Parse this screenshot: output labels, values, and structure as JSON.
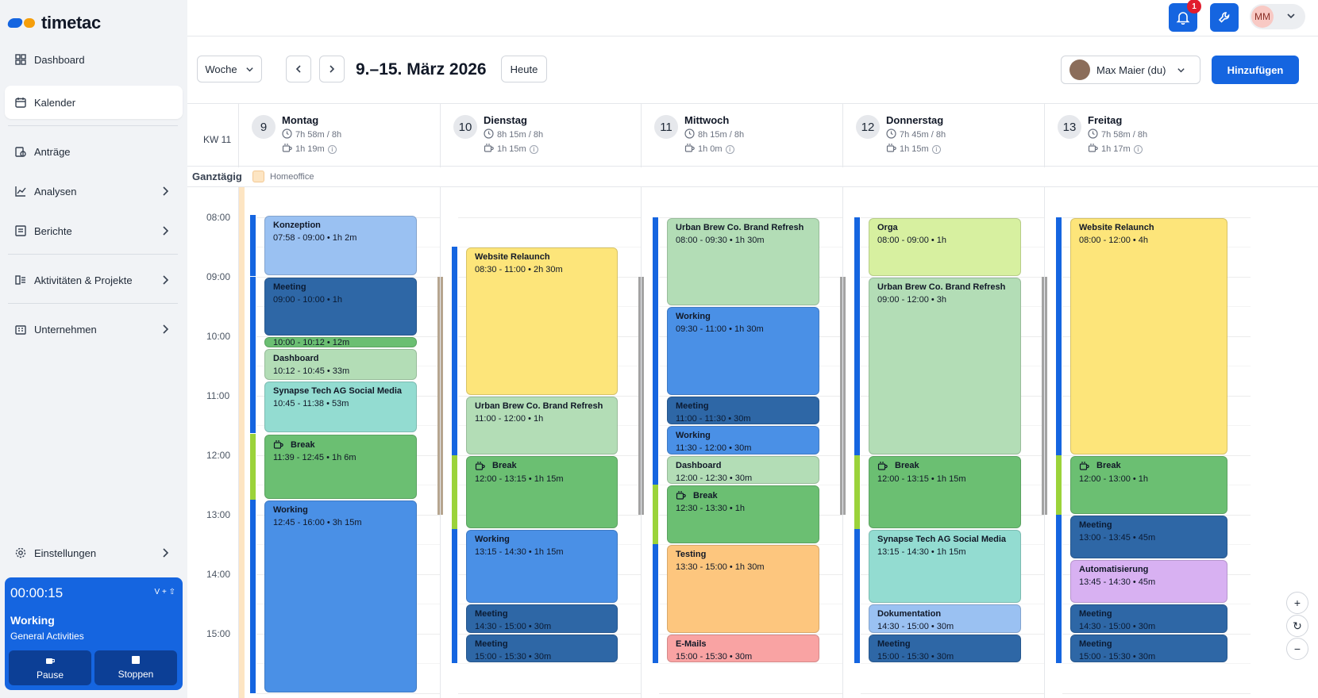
{
  "app": {
    "brand": "timetac"
  },
  "sidebar": {
    "items": [
      {
        "label": "Dashboard",
        "icon": "dashboard-icon"
      },
      {
        "label": "Kalender",
        "icon": "calendar-icon"
      },
      {
        "label": "Anträge",
        "icon": "requests-icon"
      },
      {
        "label": "Analysen",
        "icon": "chart-icon"
      },
      {
        "label": "Berichte",
        "icon": "reports-icon"
      },
      {
        "label": "Aktivitäten & Projekte",
        "icon": "projects-icon"
      },
      {
        "label": "Unternehmen",
        "icon": "building-icon"
      },
      {
        "label": "Einstellungen",
        "icon": "gear-icon"
      }
    ]
  },
  "timer": {
    "time": "00:00:15",
    "shortcut": "V + ⇧",
    "title": "Working",
    "subtitle": "General Activities",
    "pause_label": "Pause",
    "stop_label": "Stoppen"
  },
  "header": {
    "notifications": "1",
    "user_initials": "MM"
  },
  "toolbar": {
    "view": "Woche",
    "date_range": "9.–15. März 2026",
    "today": "Heute",
    "person": "Max Maier (du)",
    "add": "Hinzufügen"
  },
  "calendar": {
    "week_label": "KW 11",
    "allday_label": "Ganztägig",
    "allday_event": "Homeoffice",
    "hours": [
      "08:00",
      "09:00",
      "10:00",
      "11:00",
      "12:00",
      "13:00",
      "14:00",
      "15:00"
    ],
    "days": [
      {
        "num": "9",
        "name": "Montag",
        "work": "7h 58m / 8h",
        "break": "1h 19m"
      },
      {
        "num": "10",
        "name": "Dienstag",
        "work": "8h 15m / 8h",
        "break": "1h 15m"
      },
      {
        "num": "11",
        "name": "Mittwoch",
        "work": "8h 15m / 8h",
        "break": "1h 0m"
      },
      {
        "num": "12",
        "name": "Donnerstag",
        "work": "7h 45m / 8h",
        "break": "1h 15m"
      },
      {
        "num": "13",
        "name": "Freitag",
        "work": "7h 58m / 8h",
        "break": "1h 17m"
      }
    ]
  },
  "events": [
    [
      {
        "title": "Konzeption",
        "time": "07:58 - 09:00 • 1h 2m",
        "start": 7.967,
        "end": 9.0,
        "color": "#9ac1f2"
      },
      {
        "title": "Meeting",
        "time": "09:00 - 10:00 • 1h",
        "start": 9.0,
        "end": 10.0,
        "color": "#2e67a6"
      },
      {
        "title": "",
        "time": "10:00 - 10:12 • 12m",
        "start": 10.0,
        "end": 10.2,
        "color": "#6bbf72"
      },
      {
        "title": "Dashboard",
        "time": "10:12 - 10:45 • 33m",
        "start": 10.2,
        "end": 10.75,
        "color": "#b3ddb6"
      },
      {
        "title": "Synapse Tech AG Social Media",
        "time": "10:45 - 11:38 • 53m",
        "start": 10.75,
        "end": 11.633,
        "color": "#93dcd1"
      },
      {
        "title": "Break",
        "time": "11:39 - 12:45 • 1h 6m",
        "start": 11.65,
        "end": 12.75,
        "color": "#6bbf72",
        "icon": "coffee"
      },
      {
        "title": "Working",
        "time": "12:45 - 16:00 • 3h 15m",
        "start": 12.75,
        "end": 16.0,
        "color": "#4a90e6"
      }
    ],
    [
      {
        "title": "Website Relaunch",
        "time": "08:30 - 11:00 • 2h 30m",
        "start": 8.5,
        "end": 11.0,
        "color": "#fde57a"
      },
      {
        "title": "Urban Brew Co. Brand Refresh",
        "time": "11:00 - 12:00 • 1h",
        "start": 11.0,
        "end": 12.0,
        "color": "#b3ddb6"
      },
      {
        "title": "Break",
        "time": "12:00 - 13:15 • 1h 15m",
        "start": 12.0,
        "end": 13.25,
        "color": "#6bbf72",
        "icon": "coffee"
      },
      {
        "title": "Working",
        "time": "13:15 - 14:30 • 1h 15m",
        "start": 13.25,
        "end": 14.5,
        "color": "#4a90e6"
      },
      {
        "title": "Meeting",
        "time": "14:30 - 15:00 • 30m",
        "start": 14.5,
        "end": 15.0,
        "color": "#2e67a6"
      },
      {
        "title": "Meeting",
        "time": "15:00 - 15:30 • 30m",
        "start": 15.0,
        "end": 15.5,
        "color": "#2e67a6"
      }
    ],
    [
      {
        "title": "Urban Brew Co. Brand Refresh",
        "time": "08:00 - 09:30 • 1h 30m",
        "start": 8.0,
        "end": 9.5,
        "color": "#b3ddb6"
      },
      {
        "title": "Working",
        "time": "09:30 - 11:00 • 1h 30m",
        "start": 9.5,
        "end": 11.0,
        "color": "#4a90e6"
      },
      {
        "title": "Meeting",
        "time": "11:00 - 11:30 • 30m",
        "start": 11.0,
        "end": 11.5,
        "color": "#2e67a6"
      },
      {
        "title": "Working",
        "time": "11:30 - 12:00 • 30m",
        "start": 11.5,
        "end": 12.0,
        "color": "#4a90e6"
      },
      {
        "title": "Dashboard",
        "time": "12:00 - 12:30 • 30m",
        "start": 12.0,
        "end": 12.5,
        "color": "#b3ddb6"
      },
      {
        "title": "Break",
        "time": "12:30 - 13:30 • 1h",
        "start": 12.5,
        "end": 13.5,
        "color": "#6bbf72",
        "icon": "coffee"
      },
      {
        "title": "Testing",
        "time": "13:30 - 15:00 • 1h 30m",
        "start": 13.5,
        "end": 15.0,
        "color": "#fdc67e"
      },
      {
        "title": "E-Mails",
        "time": "15:00 - 15:30 • 30m",
        "start": 15.0,
        "end": 15.5,
        "color": "#f9a3a3"
      }
    ],
    [
      {
        "title": "Orga",
        "time": "08:00 - 09:00 • 1h",
        "start": 8.0,
        "end": 9.0,
        "color": "#d7f0a0"
      },
      {
        "title": "Urban Brew Co. Brand Refresh",
        "time": "09:00 - 12:00 • 3h",
        "start": 9.0,
        "end": 12.0,
        "color": "#b3ddb6"
      },
      {
        "title": "Break",
        "time": "12:00 - 13:15 • 1h 15m",
        "start": 12.0,
        "end": 13.25,
        "color": "#6bbf72",
        "icon": "coffee"
      },
      {
        "title": "Synapse Tech AG Social Media",
        "time": "13:15 - 14:30 • 1h 15m",
        "start": 13.25,
        "end": 14.5,
        "color": "#93dcd1"
      },
      {
        "title": "Dokumentation",
        "time": "14:30 - 15:00 • 30m",
        "start": 14.5,
        "end": 15.0,
        "color": "#9ac1f2"
      },
      {
        "title": "Meeting",
        "time": "15:00 - 15:30 • 30m",
        "start": 15.0,
        "end": 15.5,
        "color": "#2e67a6"
      }
    ],
    [
      {
        "title": "Website Relaunch",
        "time": "08:00 - 12:00 • 4h",
        "start": 8.0,
        "end": 12.0,
        "color": "#fde57a"
      },
      {
        "title": "Break",
        "time": "12:00 - 13:00 • 1h",
        "start": 12.0,
        "end": 13.0,
        "color": "#6bbf72",
        "icon": "coffee"
      },
      {
        "title": "Meeting",
        "time": "13:00 - 13:45 • 45m",
        "start": 13.0,
        "end": 13.75,
        "color": "#2e67a6"
      },
      {
        "title": "Automatisierung",
        "time": "13:45 - 14:30 • 45m",
        "start": 13.75,
        "end": 14.5,
        "color": "#d8b1f2"
      },
      {
        "title": "Meeting",
        "time": "14:30 - 15:00 • 30m",
        "start": 14.5,
        "end": 15.0,
        "color": "#2e67a6"
      },
      {
        "title": "Meeting",
        "time": "15:00 - 15:30 • 30m",
        "start": 15.0,
        "end": 15.5,
        "color": "#2e67a6"
      }
    ]
  ]
}
